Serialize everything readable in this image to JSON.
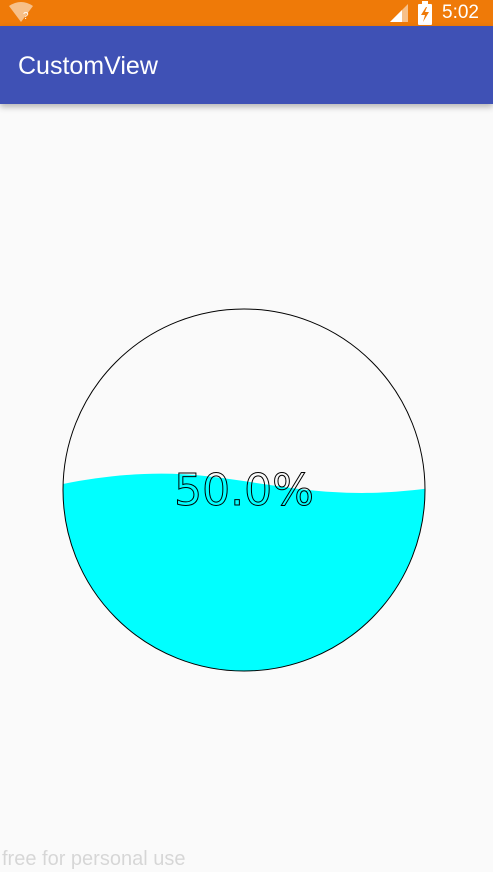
{
  "status_bar": {
    "time": "5:02",
    "background_color": "#EF7A08",
    "icons": [
      "wifi-unknown-icon",
      "cell-signal-icon",
      "battery-charging-icon"
    ]
  },
  "app_bar": {
    "title": "CustomView",
    "background_color": "#3F51B5"
  },
  "wave_progress": {
    "progress_text": "50.0%",
    "progress": 0.5,
    "fill_color": "#00FFFF",
    "outline_color": "#000000"
  },
  "watermark": {
    "text": "free for personal use"
  }
}
